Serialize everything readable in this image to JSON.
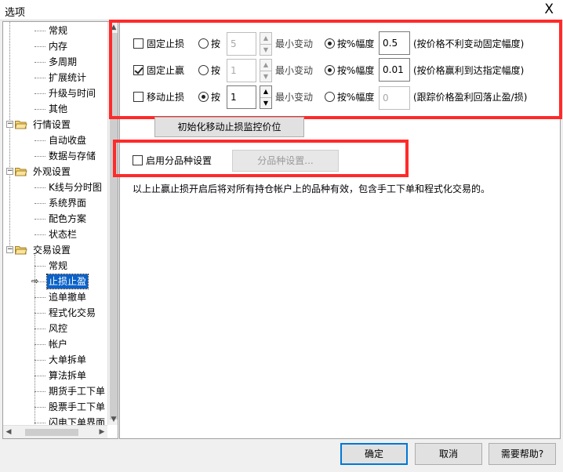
{
  "window": {
    "title": "选项",
    "close": "X"
  },
  "tree": {
    "items": [
      {
        "label": "常规"
      },
      {
        "label": "内存"
      },
      {
        "label": "多周期"
      },
      {
        "label": "扩展统计"
      },
      {
        "label": "升级与时间"
      },
      {
        "label": "其他"
      },
      {
        "label": "行情设置",
        "group": true,
        "toggle": "−"
      },
      {
        "label": "自动收盘"
      },
      {
        "label": "数据与存储"
      },
      {
        "label": "外观设置",
        "group": true,
        "toggle": "−"
      },
      {
        "label": "K线与分时图"
      },
      {
        "label": "系统界面"
      },
      {
        "label": "配色方案"
      },
      {
        "label": "状态栏"
      },
      {
        "label": "交易设置",
        "group": true,
        "toggle": "−"
      },
      {
        "label": "常规"
      },
      {
        "label": "止损止盈",
        "selected": true
      },
      {
        "label": "追单撤单"
      },
      {
        "label": "程式化交易"
      },
      {
        "label": "风控"
      },
      {
        "label": "帐户"
      },
      {
        "label": "大单拆单"
      },
      {
        "label": "算法拆单"
      },
      {
        "label": "期货手工下单"
      },
      {
        "label": "股票手工下单"
      },
      {
        "label": "闪电下单界面"
      }
    ],
    "scroll_up": "▲",
    "scroll_down": "▼",
    "scroll_left": "◀",
    "scroll_right": "▶",
    "selected_arrow": "⇨"
  },
  "stop": {
    "rows": [
      {
        "checkbox_label": "固定止损",
        "checked": false,
        "by_label": "按",
        "by_selected": false,
        "value": "5",
        "value_enabled": false,
        "min_change": "最小变动",
        "pct_label": "按%幅度",
        "pct_selected": true,
        "pct_value": "0.5",
        "pct_enabled": true,
        "note": "(按价格不利变动固定幅度)"
      },
      {
        "checkbox_label": "固定止赢",
        "checked": true,
        "by_label": "按",
        "by_selected": false,
        "value": "1",
        "value_enabled": false,
        "min_change": "最小变动",
        "pct_label": "按%幅度",
        "pct_selected": true,
        "pct_value": "0.01",
        "pct_enabled": true,
        "note": "(按价格赢利到达指定幅度)"
      },
      {
        "checkbox_label": "移动止损",
        "checked": false,
        "by_label": "按",
        "by_selected": true,
        "value": "1",
        "value_enabled": true,
        "min_change": "最小变动",
        "pct_label": "按%幅度",
        "pct_selected": false,
        "pct_value": "0",
        "pct_enabled": false,
        "note": "(跟踪价格盈利回落止盈/损)"
      }
    ],
    "init_button": "初始化移动止损监控价位",
    "per_variety_label": "启用分品种设置",
    "per_variety_checked": false,
    "per_variety_button": "分品种设置...",
    "info_text": "以上止赢止损开启后将对所有持仓帐户上的品种有效，包含手工下单和程式化交易的。"
  },
  "footer": {
    "ok": "确定",
    "cancel": "取消",
    "help": "需要帮助?"
  },
  "colors": {
    "highlight": "#ff2a2a",
    "selection": "#0a62c9",
    "default_button_border": "#0078d7"
  }
}
